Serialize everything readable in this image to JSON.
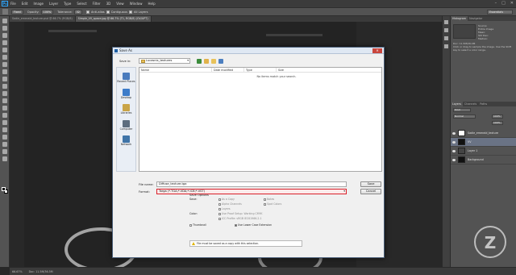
{
  "menubar": {
    "logo": "Ps",
    "items": [
      "File",
      "Edit",
      "Image",
      "Layer",
      "Type",
      "Select",
      "Filter",
      "3D",
      "View",
      "Window",
      "Help"
    ]
  },
  "options": {
    "mode_value": "Fixed",
    "opacity_label": "Opacity:",
    "opacity_value": "100%",
    "tolerance_label": "Tolerance:",
    "tolerance_value": "32",
    "antialias_label": "Anti-alias",
    "contiguous_label": "Contiguous",
    "all_layers_label": "All Layers",
    "workspace_value": "Essentials"
  },
  "doc_tabs": [
    {
      "label": "Sadie_emerald_texture.psd @ 66.7% (RGB/8)",
      "active": false
    },
    {
      "label": "Simple_VV_space.jpg @ 66.7% (T1, RGB/8) (OV/UPT)",
      "active": true
    }
  ],
  "status": {
    "zoom": "66.67%",
    "doc": "Doc: 11.5M/36.5M"
  },
  "panels": {
    "hist_tabs": [
      "Histogram",
      "Navigator"
    ],
    "hist_side": [
      "Source:",
      "Entire Image",
      "Mean:",
      "Std Dev:",
      "Median:"
    ],
    "doc_line": "Doc: 11.5M/26.4M",
    "hint": "Click or drag to sample the image. Use the Shift key to select a color range.",
    "layer_tabs": [
      "Layers",
      "Channels",
      "Paths"
    ],
    "kind_value": "Kind",
    "blend_value": "Normal",
    "opacity_value": "100%",
    "fill_value": "100%",
    "layers": [
      {
        "name": "Sadie_emerald_texture",
        "thumb": "light",
        "selected": false
      },
      {
        "name": "VV",
        "thumb": "dark",
        "selected": true
      },
      {
        "name": "Layer 1",
        "thumb": "mid",
        "selected": false
      },
      {
        "name": "Background",
        "thumb": "dark",
        "selected": false
      }
    ]
  },
  "dialog": {
    "title": "Save As",
    "close": "✕",
    "save_in_label": "Save in:",
    "save_in_value": "Lucasnix_textures",
    "places": [
      {
        "label": "Recent Places",
        "color": "#4a7bbd"
      },
      {
        "label": "Desktop",
        "color": "#3d7cc9"
      },
      {
        "label": "Libraries",
        "color": "#c9a447"
      },
      {
        "label": "Computer",
        "color": "#5d6d7e"
      },
      {
        "label": "Network",
        "color": "#3f74a8"
      }
    ],
    "columns": [
      "Name",
      "Date modified",
      "Type",
      "Size"
    ],
    "empty_message": "No items match your search.",
    "filename_label": "File name:",
    "filename_value": "Diffuse_texture.tga",
    "format_label": "Format:",
    "format_value": "Targa (*.TGA;*.VDA;*.ICB;*.VST)",
    "save_button": "Save",
    "cancel_button": "Cancel",
    "save_options_title": "Save Options",
    "save_label": "Save:",
    "color_label": "Color:",
    "thumbnail_label": "Thumbnail",
    "opts": {
      "as_copy": "As a Copy",
      "notes": "Notes",
      "alpha": "Alpha Channels",
      "spot": "Spot Colors",
      "layers": "Layers",
      "proof": "Use Proof Setup: Working CMYK",
      "icc": "ICC Profile: sRGB IEC61966-2.1",
      "lowercase": "Use Lower Case Extension"
    },
    "warning": "File must be saved as a copy with this selection."
  },
  "watermark": "Z"
}
